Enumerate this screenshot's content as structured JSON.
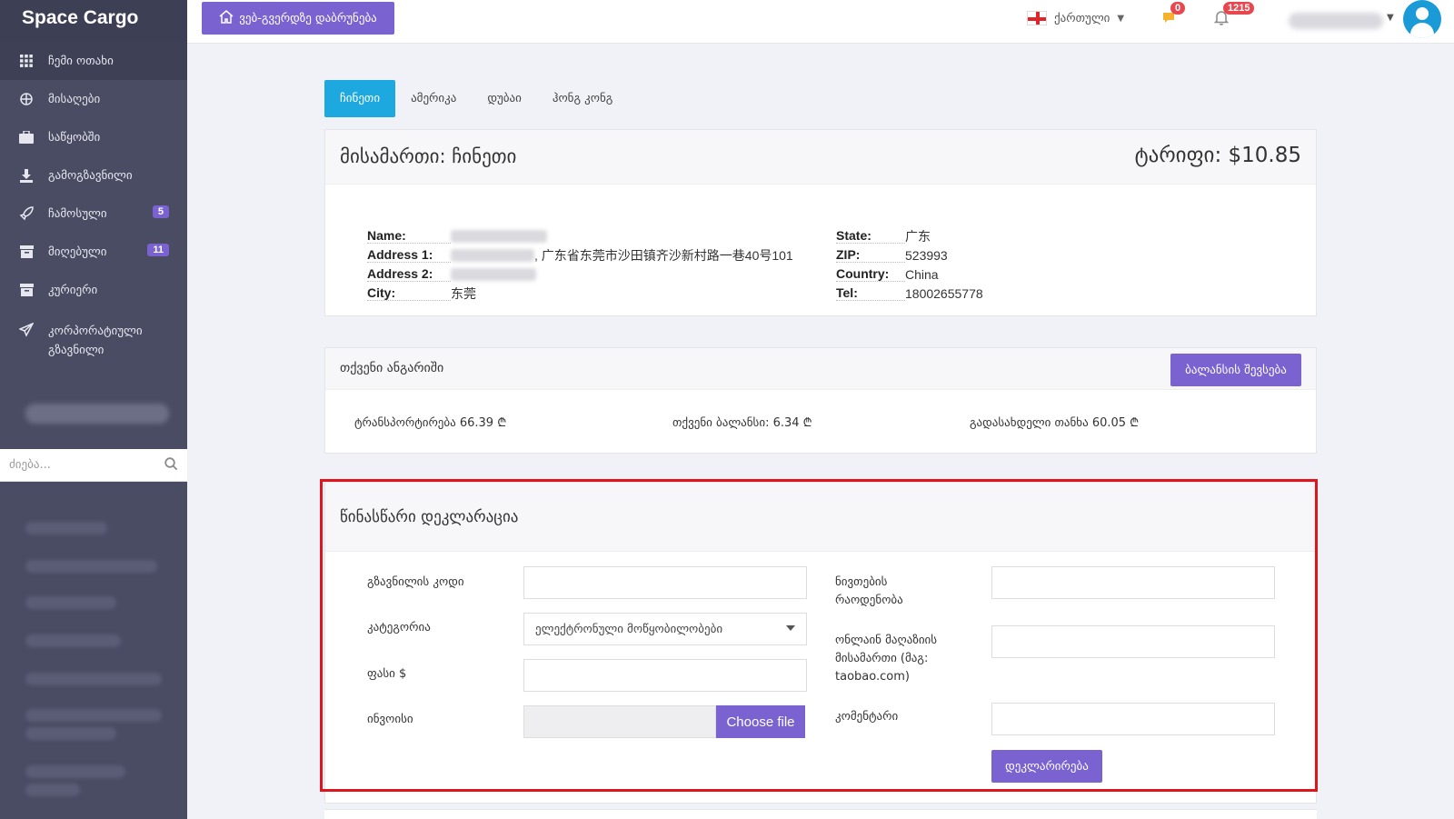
{
  "brand": "Space Cargo",
  "sidebar": {
    "items": [
      {
        "label": "ჩემი ოთახი",
        "icon": "grid-icon"
      },
      {
        "label": "მისაღები",
        "icon": "cube-stack-icon"
      },
      {
        "label": "საწყობში",
        "icon": "briefcase-icon"
      },
      {
        "label": "გამოგზავნილი",
        "icon": "download-icon"
      },
      {
        "label": "ჩამოსული",
        "icon": "rocket-icon",
        "badge": "5"
      },
      {
        "label": "მიღებული",
        "icon": "archive-icon",
        "badge": "11"
      },
      {
        "label": "კურიერი",
        "icon": "archive-icon"
      },
      {
        "label": "კორპორატიული გზავნილი",
        "icon": "send-icon"
      }
    ],
    "search_placeholder": "ძიება..."
  },
  "topbar": {
    "home_button": "ვებ-გვერდზე დაბრუნება",
    "language": "ქართული",
    "messages_count": "0",
    "notifications_count": "1215"
  },
  "tabs": [
    {
      "label": "ჩინეთი",
      "active": true
    },
    {
      "label": "ამერიკა",
      "active": false
    },
    {
      "label": "დუბაი",
      "active": false
    },
    {
      "label": "ჰონგ კონგ",
      "active": false
    }
  ],
  "address": {
    "title": "მისამართი: ჩინეთი",
    "tariff": "ტარიფი: $10.85",
    "left": [
      {
        "key": "Name:",
        "value": ""
      },
      {
        "key": "Address 1:",
        "value": ", 广东省东莞市沙田镇齐沙新村路一巷40号101"
      },
      {
        "key": "Address 2:",
        "value": ""
      },
      {
        "key": "City:",
        "value": "东莞"
      }
    ],
    "right": [
      {
        "key": "State:",
        "value": "广东"
      },
      {
        "key": "ZIP:",
        "value": "523993"
      },
      {
        "key": "Country:",
        "value": "China"
      },
      {
        "key": "Tel:",
        "value": "18002655778"
      }
    ]
  },
  "account": {
    "title": "თქვენი ანგარიში",
    "topup_button": "ბალანსის შევსება",
    "transport": "ტრანსპორტირება 66.39 ₾",
    "balance": "თქვენი ბალანსი: 6.34 ₾",
    "payable": "გადასახდელი თანხა 60.05 ₾"
  },
  "declaration": {
    "title": "წინასწარი დეკლარაცია",
    "tracking_label": "გზავნილის კოდი",
    "category_label": "კატეგორია",
    "category_value": "ელექტრონული მოწყობილობები",
    "price_label": "ფასი $",
    "invoice_label": "ინვოისი",
    "choose_file": "Choose file",
    "quantity_label": "ნივთების რაოდენობა",
    "shop_label": "ონლაინ მაღაზიის მისამართი (მაგ: taobao.com)",
    "comment_label": "კომენტარი",
    "declare_button": "დეკლარირება"
  },
  "colors": {
    "accent": "#7a63d1",
    "tab_active": "#1ea8e0",
    "sidebar": "#4a4c64",
    "highlight": "#e0141c"
  }
}
